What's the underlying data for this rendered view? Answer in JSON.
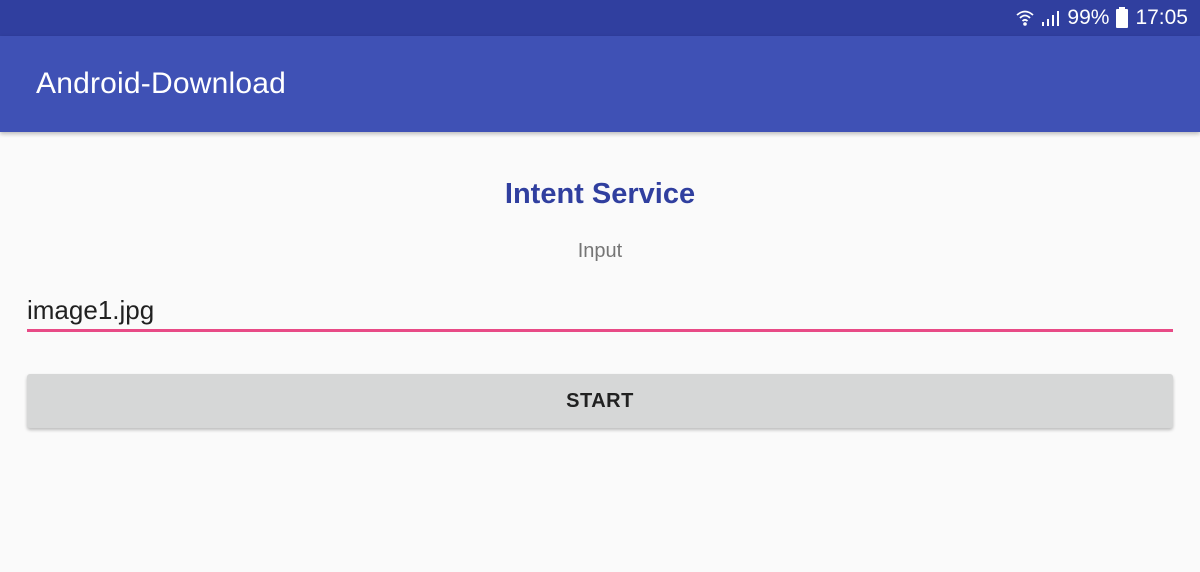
{
  "status_bar": {
    "battery_percent": "99%",
    "time": "17:05",
    "icons": [
      "wifi-icon",
      "signal-icon",
      "battery-icon"
    ]
  },
  "app_bar": {
    "title": "Android-Download"
  },
  "main": {
    "heading": "Intent Service",
    "input_label": "Input",
    "input_value": "image1.jpg",
    "start_label": "START"
  },
  "colors": {
    "status_bar": "#303f9f",
    "app_bar": "#3f51b5",
    "heading": "#303f9f",
    "input_underline": "#e84a86",
    "button": "#d6d7d7"
  }
}
